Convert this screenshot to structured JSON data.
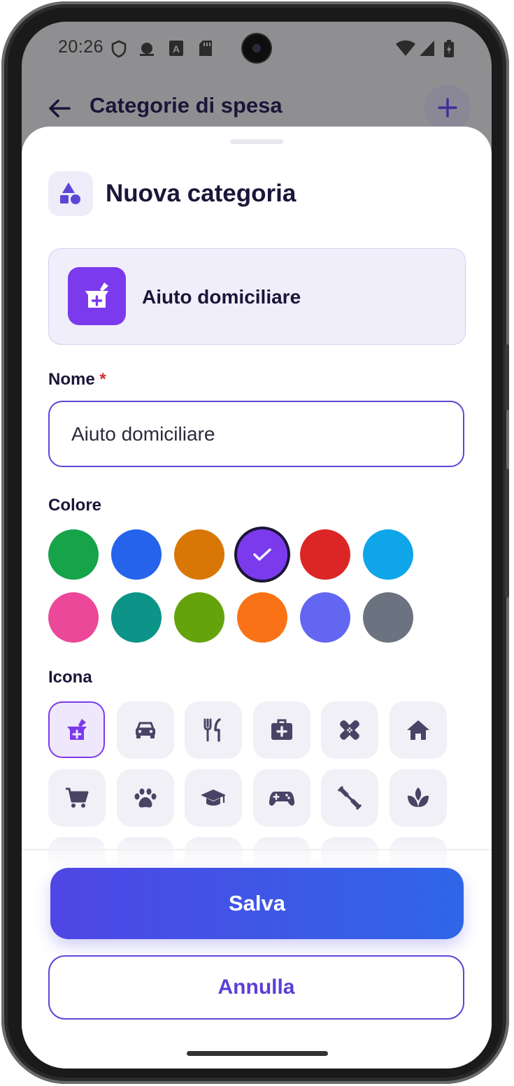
{
  "status_bar": {
    "time": "20:26"
  },
  "app_bar": {
    "title": "Categorie di spesa"
  },
  "sheet": {
    "title": "Nuova categoria",
    "preview": {
      "name": "Aiuto domiciliare",
      "icon": "mortar-pestle-plus-icon",
      "color": "#7c3aed"
    },
    "name_field": {
      "label": "Nome",
      "required_mark": "*",
      "value": "Aiuto domiciliare"
    },
    "color_section": {
      "label": "Colore",
      "selected": "#7c3aed",
      "colors": [
        "#16a34a",
        "#2563eb",
        "#d97706",
        "#7c3aed",
        "#dc2626",
        "#0ea5e9",
        "#ec4899",
        "#0d9488",
        "#65a30d",
        "#f97316",
        "#6366f1",
        "#6b7280"
      ]
    },
    "icon_section": {
      "label": "Icona",
      "selected": "mortar-pestle-plus-icon",
      "icons": [
        "mortar-pestle-plus-icon",
        "car-icon",
        "fork-knife-icon",
        "medical-bag-icon",
        "bandage-icon",
        "home-icon",
        "shopping-cart-icon",
        "paw-icon",
        "graduation-cap-icon",
        "gamepad-icon",
        "dumbbell-icon",
        "lotus-icon"
      ]
    },
    "save_label": "Salva",
    "cancel_label": "Annulla"
  }
}
